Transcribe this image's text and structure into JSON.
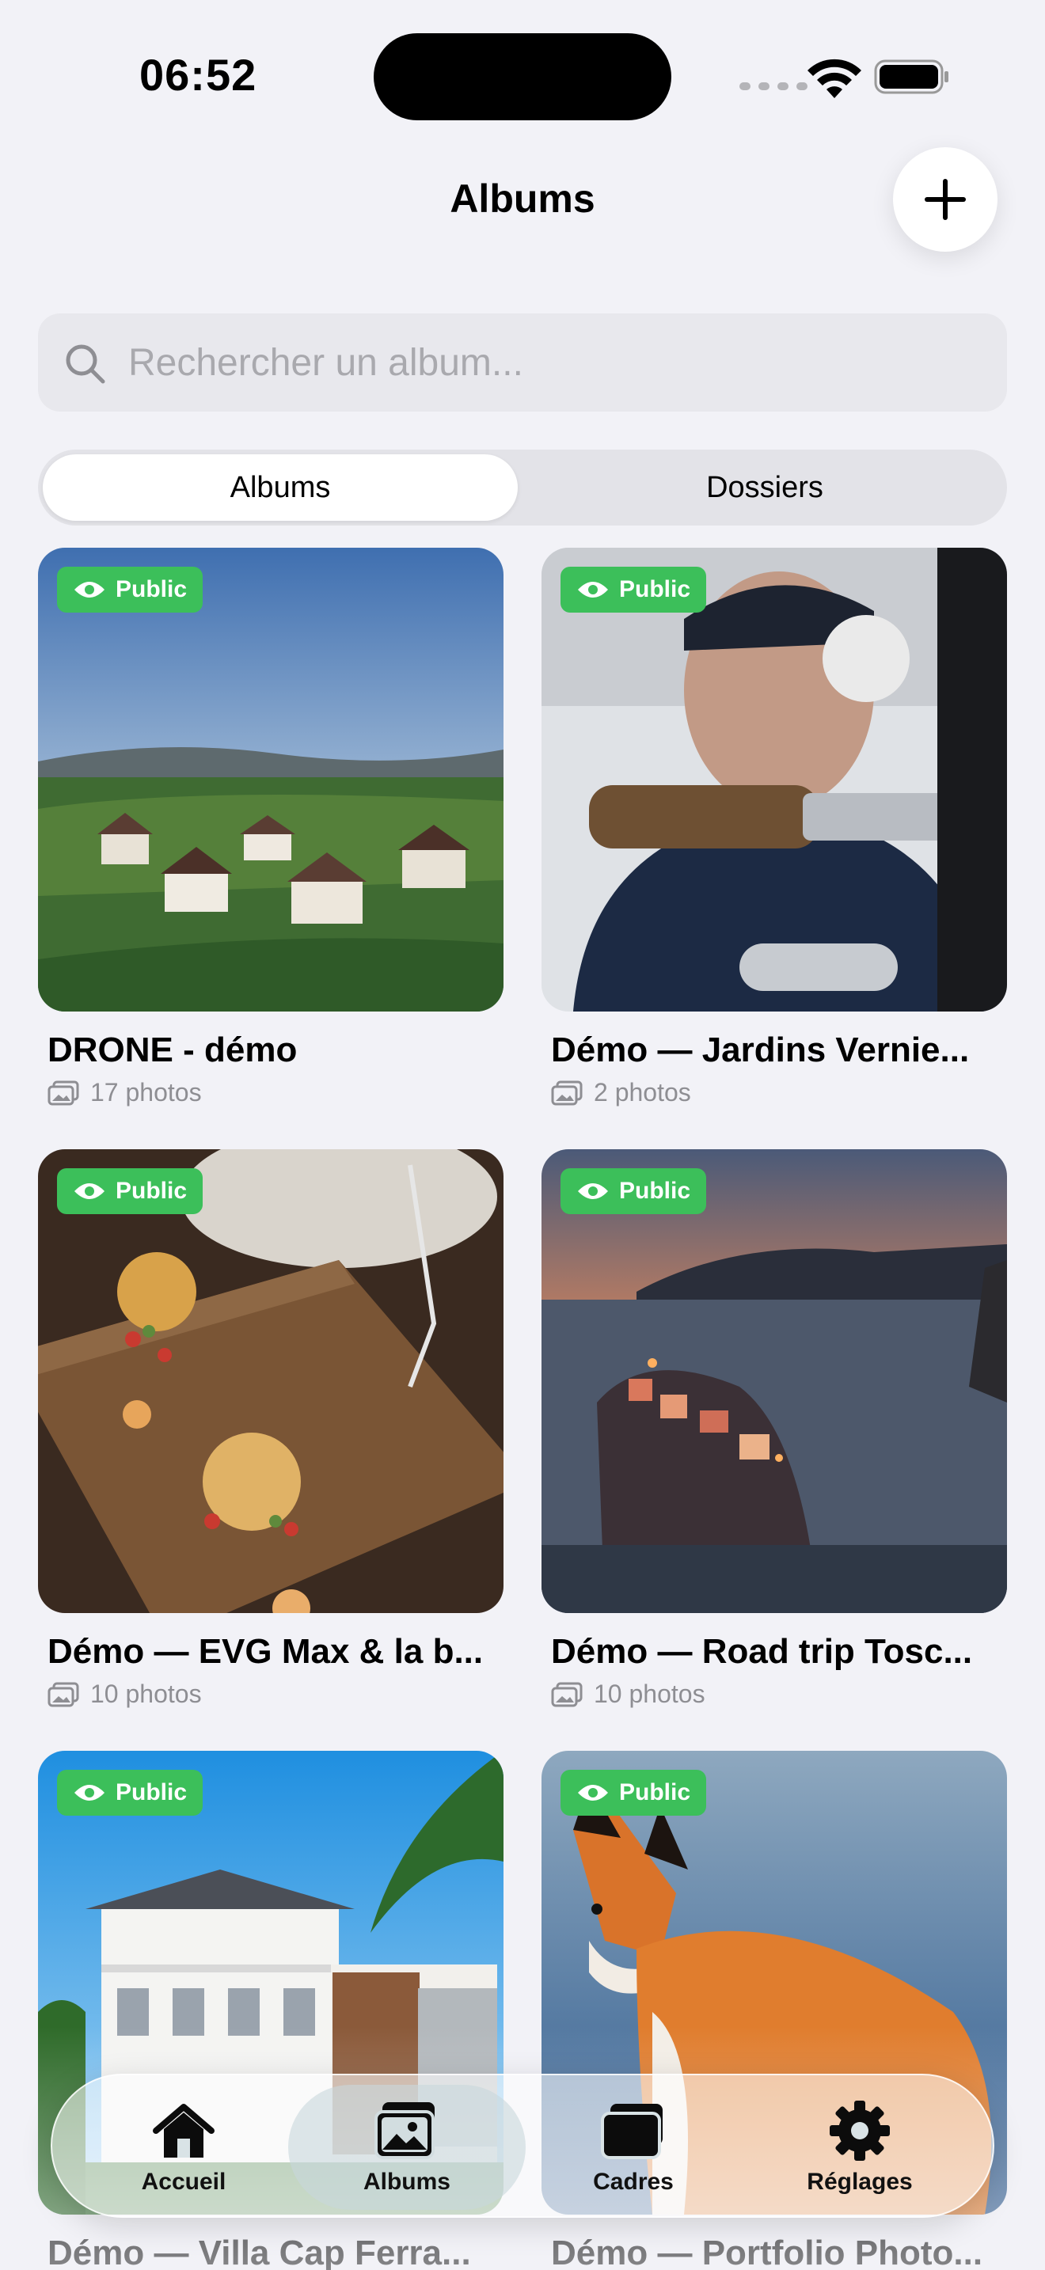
{
  "status_bar": {
    "time": "06:52"
  },
  "header": {
    "title": "Albums"
  },
  "search": {
    "placeholder": "Rechercher un album..."
  },
  "segmented": {
    "albums_label": "Albums",
    "folders_label": "Dossiers"
  },
  "badge_label": "Public",
  "albums": [
    {
      "title": "DRONE - démo",
      "count": "17 photos"
    },
    {
      "title": "Démo — Jardins Vernie...",
      "count": "2 photos"
    },
    {
      "title": "Démo — EVG Max & la b...",
      "count": "10 photos"
    },
    {
      "title": "Démo — Road trip Tosc...",
      "count": "10 photos"
    },
    {
      "title": "Démo — Villa Cap Ferra...",
      "count": ""
    },
    {
      "title": "Démo — Portfolio Photo...",
      "count": ""
    }
  ],
  "tabbar": {
    "home": "Accueil",
    "albums": "Albums",
    "frames": "Cadres",
    "settings": "Réglages"
  },
  "colors": {
    "public_badge": "#3cbf5a",
    "background": "#f2f2f7"
  }
}
